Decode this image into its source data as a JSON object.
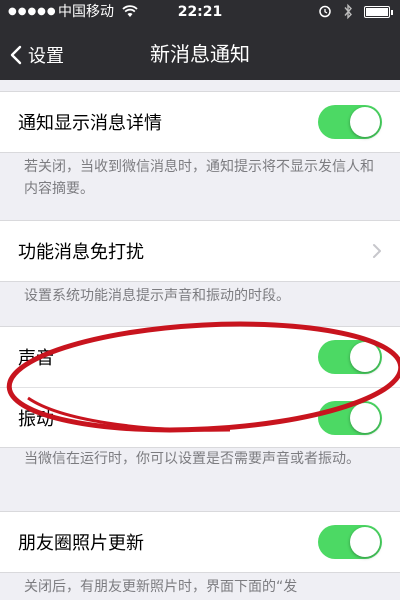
{
  "status_bar": {
    "signal": "●●●●●",
    "carrier": "中国移动",
    "time": "22:21"
  },
  "nav": {
    "back_label": "设置",
    "title": "新消息通知"
  },
  "sections": {
    "details": {
      "label": "通知显示消息详情",
      "toggle_on": true,
      "note": "若关闭，当收到微信消息时，通知提示将不显示发信人和内容摘要。"
    },
    "dnd": {
      "label": "功能消息免打扰",
      "note": "设置系统功能消息提示声音和振动的时段。"
    },
    "sound": {
      "label": "声音",
      "toggle_on": true
    },
    "vibrate": {
      "label": "振动",
      "toggle_on": true,
      "note": "当微信在运行时，你可以设置是否需要声音或者振动。"
    },
    "moments": {
      "label": "朋友圈照片更新",
      "toggle_on": true,
      "note": "关闭后，有朋友更新照片时，界面下面的“发"
    }
  },
  "colors": {
    "toggle_on": "#4cd964",
    "nav_bg": "#2d2d31",
    "annotation": "#c8141e"
  }
}
